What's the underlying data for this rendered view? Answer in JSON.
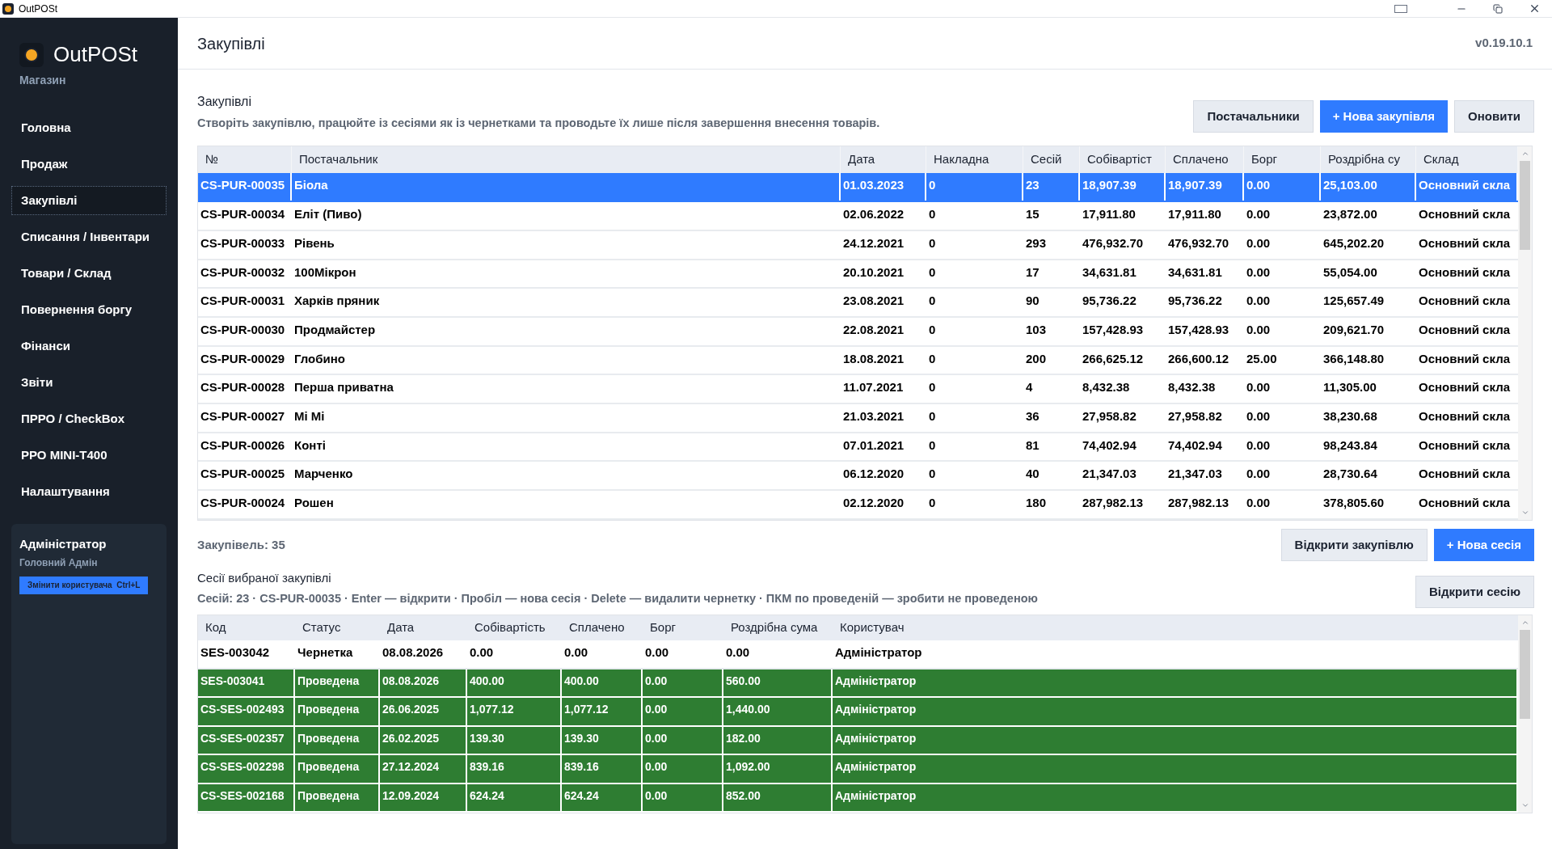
{
  "window": {
    "title": "OutPOSt"
  },
  "sidebar": {
    "app_name": "OutPOSt",
    "subtitle": "Магазин",
    "items": [
      {
        "label": "Головна",
        "selected": false
      },
      {
        "label": "Продаж",
        "selected": false
      },
      {
        "label": "Закупівлі",
        "selected": true
      },
      {
        "label": "Списання / Інвентари",
        "selected": false
      },
      {
        "label": "Товари / Склад",
        "selected": false
      },
      {
        "label": "Повернення боргу",
        "selected": false
      },
      {
        "label": "Фінанси",
        "selected": false
      },
      {
        "label": "Звіти",
        "selected": false
      },
      {
        "label": "ПРРО / CheckBox",
        "selected": false
      },
      {
        "label": "РРО MINI-T400",
        "selected": false
      },
      {
        "label": "Налаштування",
        "selected": false
      }
    ],
    "user": {
      "name": "Адміністратор",
      "role": "Головний Адмін",
      "switch_button": "Змінити користувача  Ctrl+L"
    }
  },
  "header": {
    "title": "Закупівлі",
    "version": "v0.19.10.1"
  },
  "purchases": {
    "title": "Закупівлі",
    "description": "Створіть закупівлю, працюйте із сесіями як із чернетками та проводьте їх лише після завершення внесення товарів.",
    "buttons": [
      {
        "label": "Постачальники",
        "primary": false
      },
      {
        "label": "+ Нова закупівля",
        "primary": true
      },
      {
        "label": "Оновити",
        "primary": false
      }
    ],
    "columns": [
      "№",
      "Постачальник",
      "Дата",
      "Накладна",
      "Сесій",
      "Собівартіст",
      "Сплачено",
      "Борг",
      "Роздрібна су",
      "Склад"
    ],
    "rows": [
      {
        "cells": [
          "CS-PUR-00035",
          "Біола",
          "01.03.2023",
          "0",
          "23",
          "18,907.39",
          "18,907.39",
          "0.00",
          "25,103.00",
          "Основний скла"
        ],
        "selected": true
      },
      {
        "cells": [
          "CS-PUR-00034",
          "Еліт (Пиво)",
          "02.06.2022",
          "0",
          "15",
          "17,911.80",
          "17,911.80",
          "0.00",
          "23,872.00",
          "Основний скла"
        ],
        "selected": false
      },
      {
        "cells": [
          "CS-PUR-00033",
          "Рівень",
          "24.12.2021",
          "0",
          "293",
          "476,932.70",
          "476,932.70",
          "0.00",
          "645,202.20",
          "Основний скла"
        ],
        "selected": false
      },
      {
        "cells": [
          "CS-PUR-00032",
          "100Мікрон",
          "20.10.2021",
          "0",
          "17",
          "34,631.81",
          "34,631.81",
          "0.00",
          "55,054.00",
          "Основний скла"
        ],
        "selected": false
      },
      {
        "cells": [
          "CS-PUR-00031",
          "Харків пряник",
          "23.08.2021",
          "0",
          "90",
          "95,736.22",
          "95,736.22",
          "0.00",
          "125,657.49",
          "Основний скла"
        ],
        "selected": false
      },
      {
        "cells": [
          "CS-PUR-00030",
          "Продмайстер",
          "22.08.2021",
          "0",
          "103",
          "157,428.93",
          "157,428.93",
          "0.00",
          "209,621.70",
          "Основний скла"
        ],
        "selected": false
      },
      {
        "cells": [
          "CS-PUR-00029",
          "Глобино",
          "18.08.2021",
          "0",
          "200",
          "266,625.12",
          "266,600.12",
          "25.00",
          "366,148.80",
          "Основний скла"
        ],
        "selected": false
      },
      {
        "cells": [
          "CS-PUR-00028",
          "Перша приватна",
          "11.07.2021",
          "0",
          "4",
          "8,432.38",
          "8,432.38",
          "0.00",
          "11,305.00",
          "Основний скла"
        ],
        "selected": false
      },
      {
        "cells": [
          "CS-PUR-00027",
          "Мі Мі",
          "21.03.2021",
          "0",
          "36",
          "27,958.82",
          "27,958.82",
          "0.00",
          "38,230.68",
          "Основний скла"
        ],
        "selected": false
      },
      {
        "cells": [
          "CS-PUR-00026",
          "Конті",
          "07.01.2021",
          "0",
          "81",
          "74,402.94",
          "74,402.94",
          "0.00",
          "98,243.84",
          "Основний скла"
        ],
        "selected": false
      },
      {
        "cells": [
          "CS-PUR-00025",
          "Марченко",
          "06.12.2020",
          "0",
          "40",
          "21,347.03",
          "21,347.03",
          "0.00",
          "28,730.64",
          "Основний скла"
        ],
        "selected": false
      },
      {
        "cells": [
          "CS-PUR-00024",
          "Рошен",
          "02.12.2020",
          "0",
          "180",
          "287,982.13",
          "287,982.13",
          "0.00",
          "378,805.60",
          "Основний скла"
        ],
        "selected": false
      }
    ],
    "count": "Закупівель: 35",
    "bottom_buttons": [
      {
        "label": "Відкрити закупівлю",
        "primary": false
      },
      {
        "label": "+ Нова сесія",
        "primary": true
      }
    ]
  },
  "sessions": {
    "title": "Сесії вибраної закупівлі",
    "description": "Сесій: 23 · CS-PUR-00035 · Enter — відкрити · Пробіл — нова сесія · Delete — видалити чернетку · ПКМ по проведеній — зробити не проведеною",
    "open_button": "Відкрити сесію",
    "columns": [
      "Код",
      "Статус",
      "Дата",
      "Собівартість",
      "Сплачено",
      "Борг",
      "Роздрібна сума",
      "Користувач"
    ],
    "rows": [
      {
        "cells": [
          "SES-003042",
          "Чернетка",
          "08.08.2026",
          "0.00",
          "0.00",
          "0.00",
          "0.00",
          "Адміністратор"
        ],
        "posted": false
      },
      {
        "cells": [
          "SES-003041",
          "Проведена",
          "08.08.2026",
          "400.00",
          "400.00",
          "0.00",
          "560.00",
          "Адміністратор"
        ],
        "posted": true
      },
      {
        "cells": [
          "CS-SES-002493",
          "Проведена",
          "26.06.2025",
          "1,077.12",
          "1,077.12",
          "0.00",
          "1,440.00",
          "Адміністратор"
        ],
        "posted": true
      },
      {
        "cells": [
          "CS-SES-002357",
          "Проведена",
          "26.02.2025",
          "139.30",
          "139.30",
          "0.00",
          "182.00",
          "Адміністратор"
        ],
        "posted": true
      },
      {
        "cells": [
          "CS-SES-002298",
          "Проведена",
          "27.12.2024",
          "839.16",
          "839.16",
          "0.00",
          "1,092.00",
          "Адміністратор"
        ],
        "posted": true
      },
      {
        "cells": [
          "CS-SES-002168",
          "Проведена",
          "12.09.2024",
          "624.24",
          "624.24",
          "0.00",
          "852.00",
          "Адміністратор"
        ],
        "posted": true
      }
    ]
  }
}
